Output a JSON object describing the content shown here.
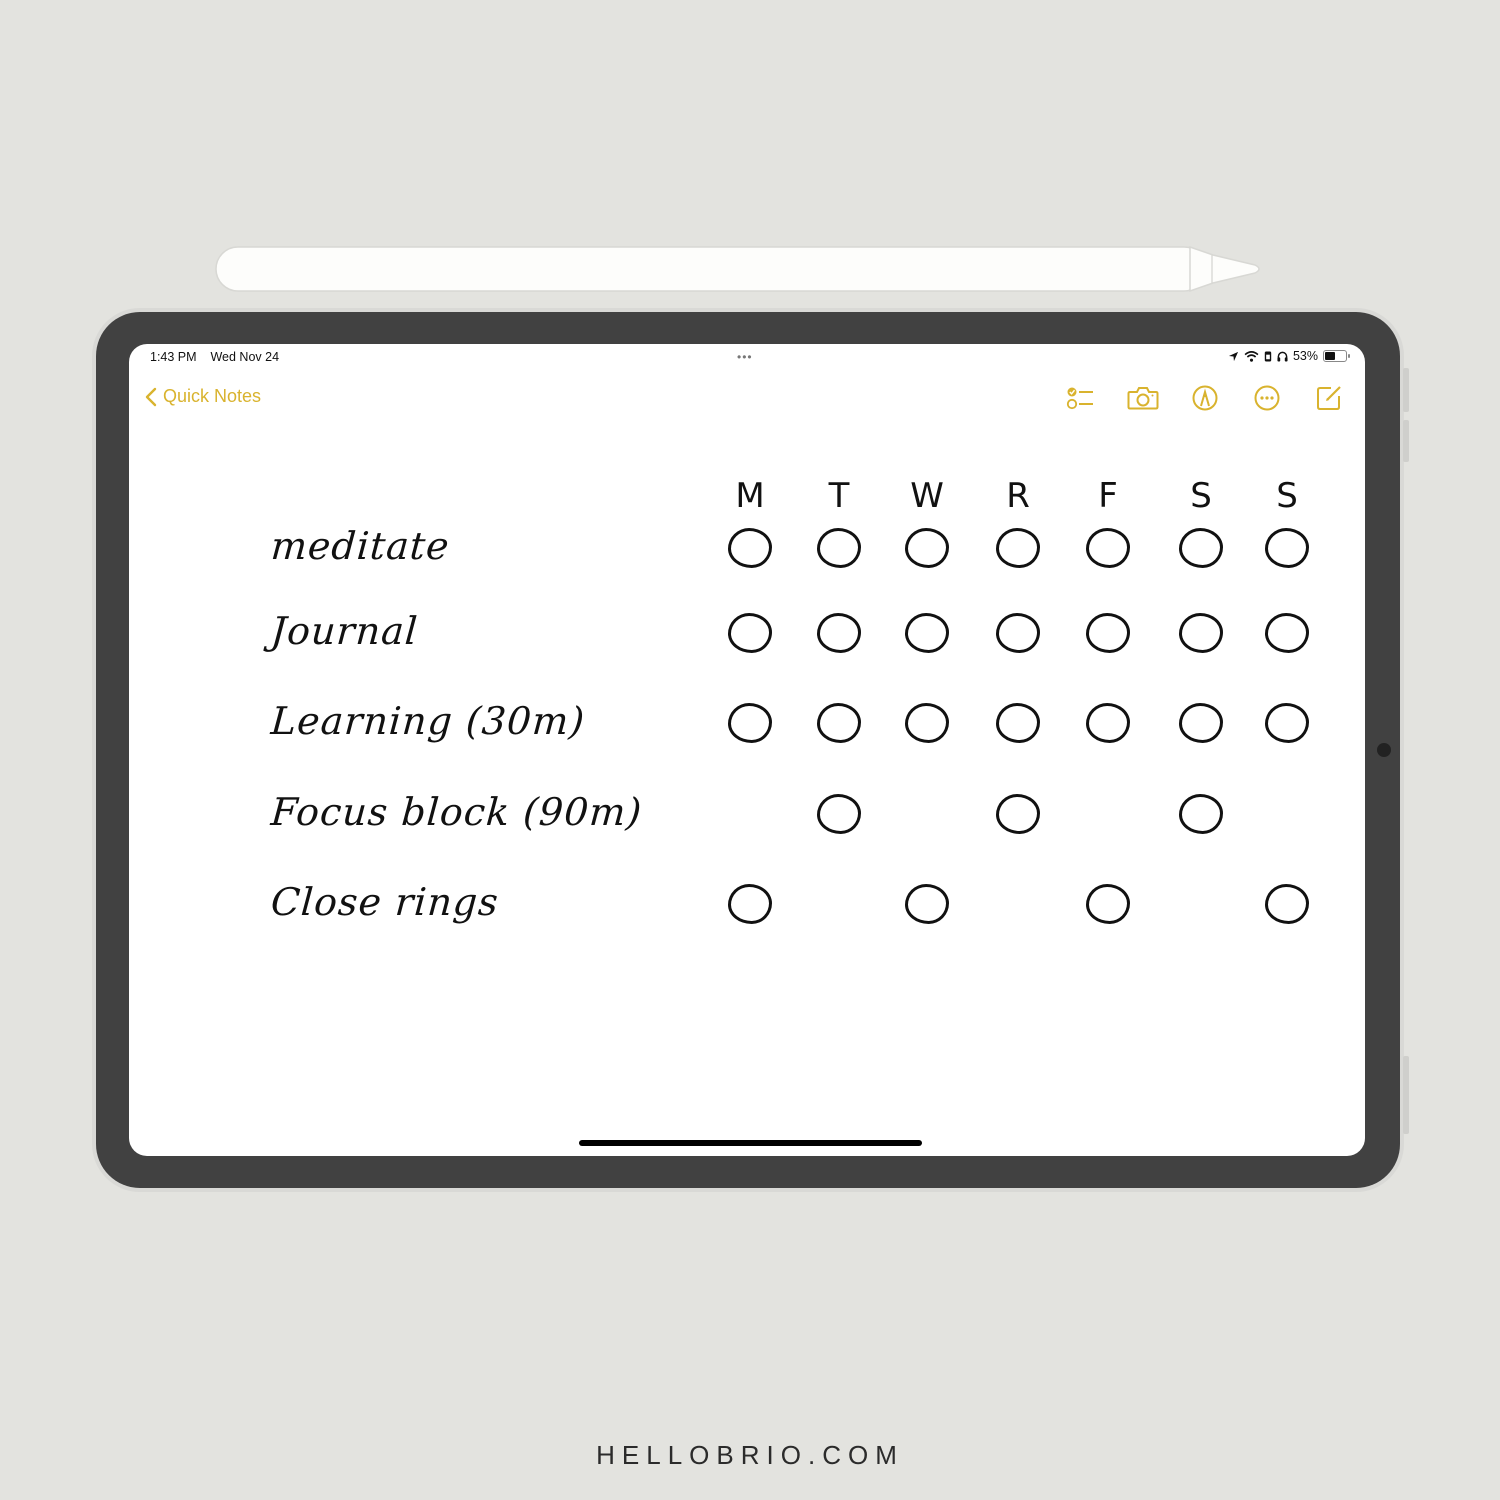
{
  "status_bar": {
    "time": "1:43 PM",
    "date": "Wed Nov 24",
    "multitask_dots": "•••",
    "battery_percent": "53%",
    "battery_level": 0.53,
    "icons": [
      "location-icon",
      "wifi-icon",
      "sim-icon",
      "headphones-icon",
      "battery-icon"
    ]
  },
  "nav": {
    "back_label": "Quick Notes",
    "accent_color": "#d9b32e",
    "toolbar": [
      {
        "name": "checklist-icon"
      },
      {
        "name": "camera-icon"
      },
      {
        "name": "markup-pen-icon"
      },
      {
        "name": "more-options-icon"
      },
      {
        "name": "compose-icon"
      }
    ]
  },
  "note": {
    "days": [
      "M",
      "T",
      "W",
      "R",
      "F",
      "S",
      "S"
    ],
    "habits": [
      {
        "label": "meditate",
        "marks": [
          1,
          1,
          1,
          1,
          1,
          1,
          1
        ]
      },
      {
        "label": "Journal",
        "marks": [
          1,
          1,
          1,
          1,
          1,
          1,
          1
        ]
      },
      {
        "label": "Learning (30m)",
        "marks": [
          1,
          1,
          1,
          1,
          1,
          1,
          1
        ]
      },
      {
        "label": "Focus block (90m)",
        "marks": [
          0,
          1,
          0,
          1,
          0,
          1,
          0
        ]
      },
      {
        "label": "Close rings",
        "marks": [
          1,
          0,
          1,
          0,
          1,
          0,
          1
        ]
      }
    ]
  },
  "footer": {
    "text": "HELLOBRIO.COM"
  }
}
